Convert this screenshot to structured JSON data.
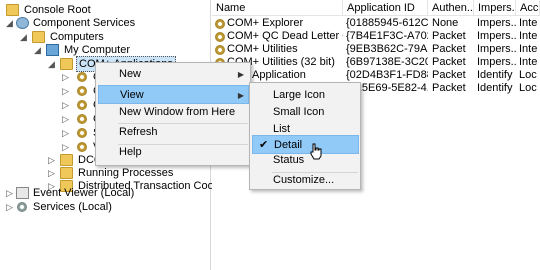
{
  "tree": {
    "console_root": "Console Root",
    "component_services": "Component Services",
    "computers": "Computers",
    "my_computer": "My Computer",
    "com_apps": "COM+ Applications",
    "child_c1": "C",
    "child_c2": "C",
    "child_c3": "C",
    "child_c4": "C",
    "child_s": "S",
    "child_v": "V",
    "dco": "DCO",
    "running": "Running Processes",
    "dtc": "Distributed Transaction Coordinat",
    "event_viewer": "Event Viewer (Local)",
    "services": "Services (Local)"
  },
  "list": {
    "columns": [
      "Name",
      "Application ID",
      "Authen...",
      "Impers...",
      "Acc"
    ],
    "rows": [
      [
        "COM+ Explorer",
        "{01885945-612C-4...",
        "None",
        "Impers...",
        "Inte"
      ],
      [
        "COM+ QC Dead Letter Que...",
        "{7B4E1F3C-A702-1...",
        "Packet",
        "Impers...",
        "Inte"
      ],
      [
        "COM+ Utilities",
        "{9EB3B62C-79A2-1...",
        "Packet",
        "Impers...",
        "Inte"
      ],
      [
        "COM+ Utilities (32 bit)",
        "{6B97138E-3C20-4...",
        "Packet",
        "Impers...",
        "Inte"
      ],
      [
        "Application",
        "{02D4B3F1-FD88-1...",
        "Packet",
        "Identify",
        "Loc"
      ],
      [
        "",
        "{015E69-5E82-4...",
        "Packet",
        "Identify",
        "Loc"
      ]
    ]
  },
  "context_menu": {
    "new": "New",
    "view": "View",
    "new_window": "New Window from Here",
    "refresh": "Refresh",
    "help": "Help"
  },
  "view_menu": {
    "large_icon": "Large Icon",
    "small_icon": "Small Icon",
    "list": "List",
    "detail": "Detail",
    "status": "Status",
    "customize": "Customize...",
    "checked": "Detail"
  }
}
